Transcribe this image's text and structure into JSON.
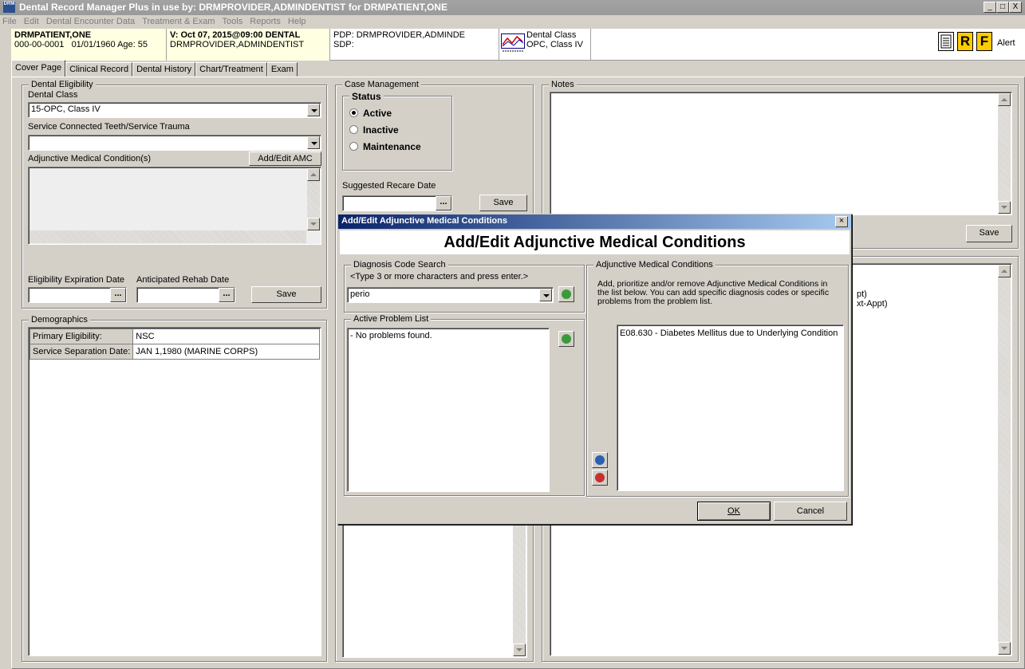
{
  "window": {
    "title": "Dental Record Manager Plus in use by: DRMPROVIDER,ADMINDENTIST for DRMPATIENT,ONE",
    "app_icon": "DRM",
    "min_glyph": "_",
    "max_glyph": "□",
    "close_glyph": "X"
  },
  "menu": [
    "File",
    "Edit",
    "Dental Encounter Data",
    "Treatment & Exam",
    "Tools",
    "Reports",
    "Help"
  ],
  "patient": {
    "name": "DRMPATIENT,ONE",
    "ssn": "000-00-0001",
    "dob": "01/01/1960",
    "age_label": "Age:",
    "age": "55",
    "visit": "V: Oct 07, 2015@09:00 DENTAL",
    "provider": "DRMPROVIDER,ADMINDENTIST",
    "pdp": "PDP: DRMPROVIDER,ADMINDE",
    "sdp": "SDP:",
    "dental_class_label": "Dental Class",
    "dental_class_value": "OPC, Class IV",
    "flag_r": "R",
    "flag_f": "F",
    "alert_label": "Alert"
  },
  "tabs": [
    "Cover Page",
    "Clinical Record",
    "Dental History",
    "Chart/Treatment",
    "Exam"
  ],
  "active_tab": "Cover Page",
  "eligibility": {
    "group_label": "Dental Eligibility",
    "dental_class_label": "Dental Class",
    "dental_class_value": "15-OPC, Class IV",
    "sc_label": "Service Connected Teeth/Service Trauma",
    "sc_value": "",
    "amc_label": "Adjunctive Medical Condition(s)",
    "amc_button": "Add/Edit AMC",
    "exp_label": "Eligibility Expiration Date",
    "rehab_label": "Anticipated Rehab Date",
    "ellipsis": "...",
    "save": "Save"
  },
  "demographics": {
    "group_label": "Demographics",
    "rows": [
      {
        "label": "Primary Eligibility:",
        "value": "NSC"
      },
      {
        "label": "Service Separation Date:",
        "value": "JAN 1,1980  (MARINE CORPS)"
      }
    ]
  },
  "case_management": {
    "group_label": "Case Management",
    "status_label": "Status",
    "options": [
      "Active",
      "Inactive",
      "Maintenance"
    ],
    "selected": "Active",
    "recare_label": "Suggested Recare Date",
    "ellipsis": "...",
    "save": "Save"
  },
  "notes": {
    "group_label": "Notes",
    "save": "Save",
    "partial_line_1": "pt)",
    "partial_line_2": "xt-Appt)"
  },
  "dialog": {
    "title": "Add/Edit Adjunctive Medical Conditions",
    "heading": "Add/Edit Adjunctive Medical Conditions",
    "close_glyph": "×",
    "search_group": "Diagnosis Code Search",
    "search_hint": "<Type 3 or more characters and press enter.>",
    "search_value": "perio",
    "problem_group": "Active Problem List",
    "problems": [
      "- No problems found."
    ],
    "amc_group": "Adjunctive Medical Conditions",
    "amc_instructions": "Add, prioritize and/or remove Adjunctive Medical Conditions in the list below.  You can add specific diagnosis codes or specific problems from the problem list.",
    "amc_items": [
      "E08.630 - Diabetes Mellitus due to Underlying Condition"
    ],
    "ok": "OK",
    "cancel": "Cancel"
  },
  "colors": {
    "title_gradient_start": "#0a246a",
    "title_gradient_end": "#a6caf0",
    "flag_bg": "#ffcc00",
    "header_patient_bg": "#ffffe1"
  }
}
